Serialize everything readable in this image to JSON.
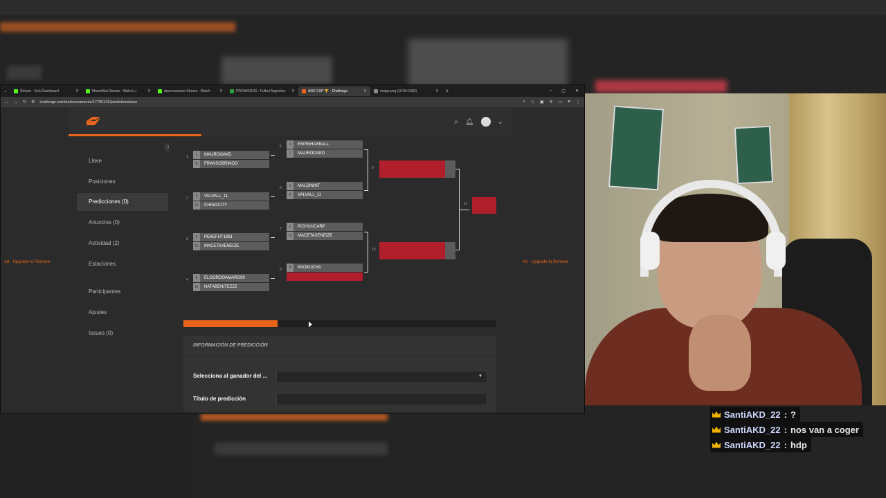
{
  "browser": {
    "tabs": [
      {
        "title": "Stream - Kick Dashboard",
        "color": "#53fc18",
        "active": false
      },
      {
        "title": "MauroAkd Stream - Watch Li",
        "color": "#53fc18",
        "active": false
      },
      {
        "title": "davooxeneize Stream - Watch",
        "color": "#53fc18",
        "active": false
      },
      {
        "title": "PROMIEDOS - Futbol Argentino",
        "color": "#2e9e3b",
        "active": false
      },
      {
        "title": "AGK CUP 🏆 - Challonge",
        "color": "#e8641b",
        "active": true
      },
      {
        "title": "image.png (1619×1080)",
        "color": "#888888",
        "active": false
      }
    ],
    "url": "challonge.com/es/tournaments/17705132/predictions/new"
  },
  "sidebar": {
    "items": [
      "Llave",
      "Posiciones",
      "Predicciones (0)",
      "Anuncios (0)",
      "Actividad (2)",
      "Estaciones",
      "Participantes",
      "Ajustes",
      "Issues (0)"
    ]
  },
  "ads": {
    "left": "Ad - Upgrade to Remove",
    "right": "Ad - Upgrade to Remove"
  },
  "bracket": {
    "round1": [
      {
        "match": "1",
        "p1": "MAUROOAKD",
        "s1": "1",
        "p2": "FRANSOBRINOO",
        "s2": "8"
      },
      {
        "match": "2",
        "p1": "VALVALL_11",
        "s1": "5",
        "p2": "CHINOCITY",
        "s2": "12"
      },
      {
        "match": "3",
        "p1": "PEKEFUT1891",
        "s1": "3",
        "p2": "MACETAXENEIZE",
        "s2": "10"
      },
      {
        "match": "4",
        "p1": "ELGORDOAMARO99",
        "s1": "6",
        "p2": "NATABENITEZZZ",
        "s2": "11"
      }
    ],
    "round2": [
      {
        "match": "5",
        "p1": "ESPINHAXBALL",
        "s1": "4",
        "p2": "MAUROOAKD",
        "s2": "1"
      },
      {
        "match": "6",
        "p1": "MALDININT",
        "s1": "2",
        "p2": "VALVALL_11",
        "s2": "5"
      },
      {
        "match": "7",
        "p1": "PICHUUCARP",
        "s1": "1",
        "p2": "MACETAXENEIZE",
        "s2": "10"
      },
      {
        "match": "8",
        "p1": "KKOKUCHA",
        "s1": "8",
        "p2": "",
        "s2": ""
      }
    ],
    "round3": [
      "9",
      "10"
    ],
    "final": "11"
  },
  "progress": {
    "value": 0.3
  },
  "form": {
    "title": "INFORMACIÓN DE PREDICCIÓN",
    "winner_label": "Selecciona al ganador del ...",
    "title_label": "Título de predicción"
  },
  "chat": [
    {
      "user": "SantiAKD_22",
      "message": "?"
    },
    {
      "user": "SantiAKD_22",
      "message": "nos van a coger"
    },
    {
      "user": "SantiAKD_22",
      "message": "hdp"
    }
  ],
  "colors": {
    "accent": "#e8641b",
    "prediction": "#b01f2b",
    "crown": "#f0b400"
  }
}
